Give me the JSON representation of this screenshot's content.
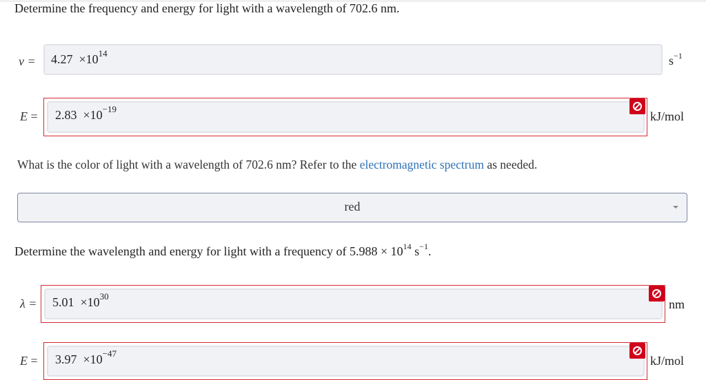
{
  "problem1": {
    "question_prefix": "Determine the frequency and energy for light with a wavelength of 702.6",
    "question_unit": "nm",
    "question_end": ".",
    "frequency": {
      "label": "ν =",
      "value_mantissa": "4.27",
      "value_times": "×10",
      "value_exponent": "14",
      "unit_base": "s",
      "unit_exponent": "−1",
      "status": "unmarked"
    },
    "energy": {
      "label_var": "E",
      "label_eq": "=",
      "value_mantissa": "2.83",
      "value_times": "×10",
      "value_exponent": "−19",
      "unit": "kJ/mol",
      "status": "incorrect"
    }
  },
  "problem2": {
    "question_prefix": "What is the color of light with a wavelength of 702.6",
    "question_unit": "nm",
    "question_mid": "? Refer to the",
    "link_text": "electromagnetic spectrum",
    "question_end": "as needed.",
    "dropdown_selected": "red"
  },
  "problem3": {
    "question_prefix": "Determine the wavelength and energy for light with a frequency of 5.988 × 10",
    "question_exp": "14",
    "question_unit_base": "s",
    "question_unit_exp": "−1",
    "question_end": ".",
    "wavelength": {
      "label": "λ =",
      "value_mantissa": "5.01",
      "value_times": "×10",
      "value_exponent": "30",
      "unit": "nm",
      "status": "incorrect"
    },
    "energy": {
      "label_var": "E",
      "label_eq": "=",
      "value_mantissa": "3.97",
      "value_times": "×10",
      "value_exponent": "−47",
      "unit": "kJ/mol",
      "status": "incorrect"
    }
  },
  "colors": {
    "error_red": "#d0021b",
    "link_blue": "#2f72b8",
    "field_bg": "#f1f2f6"
  },
  "icons": {
    "incorrect": "prohibited-icon",
    "dropdown": "caret-down-icon"
  }
}
